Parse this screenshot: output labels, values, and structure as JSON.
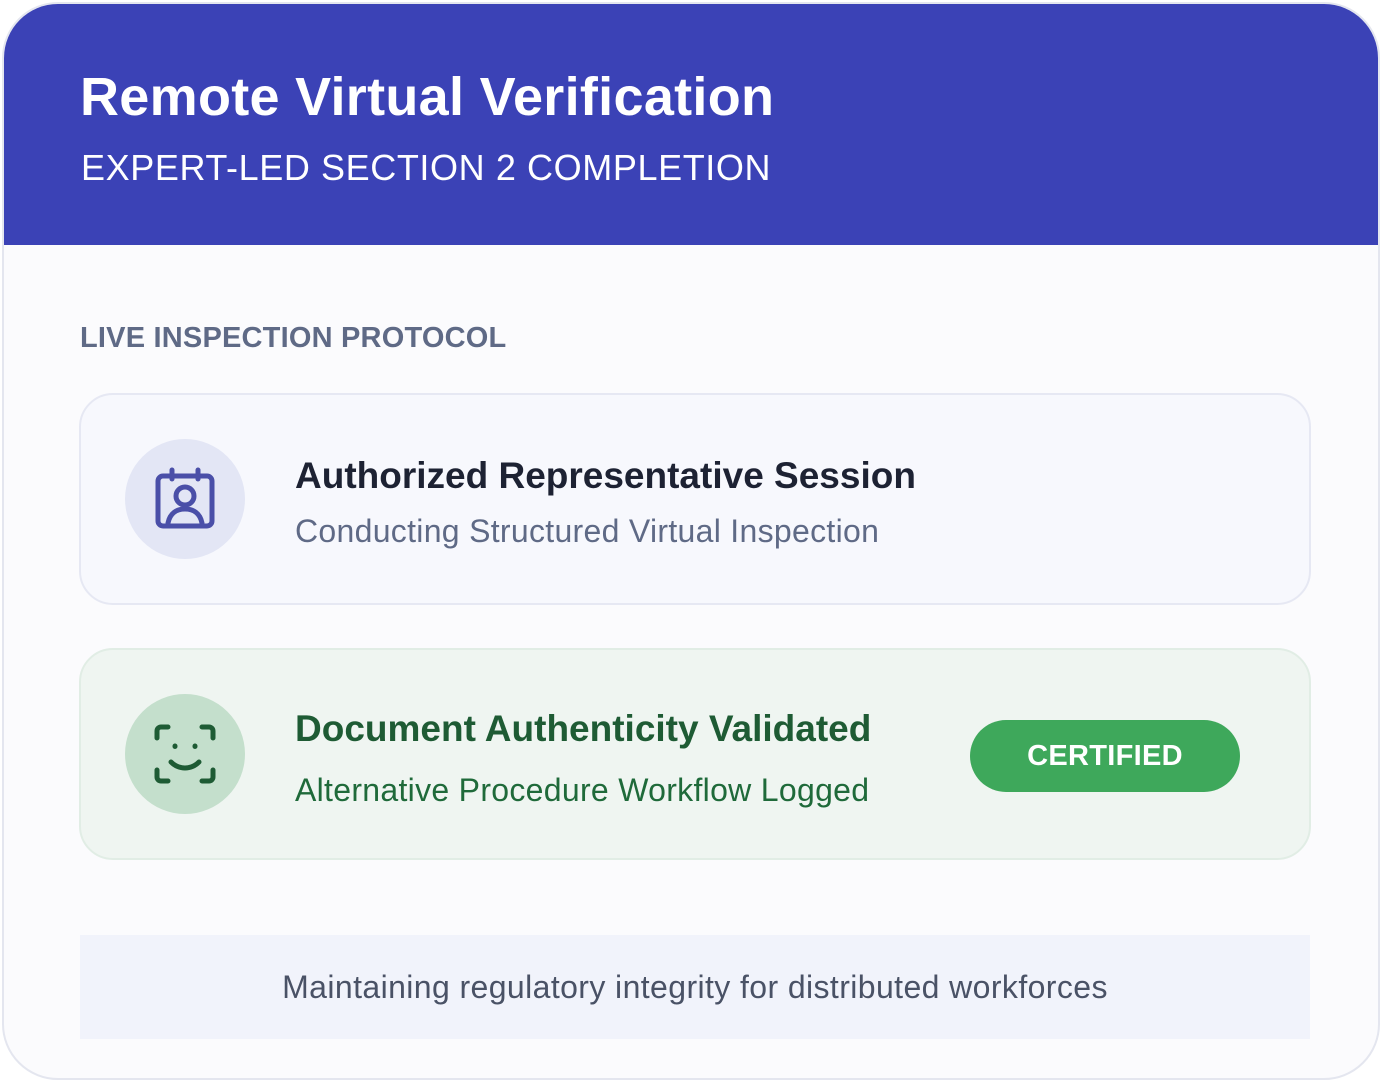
{
  "header": {
    "title": "Remote Virtual Verification",
    "subtitle": "EXPERT-LED SECTION 2 COMPLETION"
  },
  "section": {
    "label": "LIVE INSPECTION PROTOCOL"
  },
  "items": [
    {
      "title": "Authorized Representative Session",
      "subtitle": "Conducting Structured Virtual Inspection",
      "icon": "id-badge-icon"
    },
    {
      "title": "Document Authenticity Validated",
      "subtitle": "Alternative Procedure Workflow Logged",
      "icon": "face-scan-icon",
      "badge": "CERTIFIED"
    }
  ],
  "footer": {
    "text": "Maintaining regulatory integrity for distributed workforces"
  },
  "colors": {
    "header_bg": "#3b42b6",
    "success_green": "#3ea85b",
    "indigo_icon": "#4a4fa8",
    "green_icon": "#1e5b34"
  }
}
